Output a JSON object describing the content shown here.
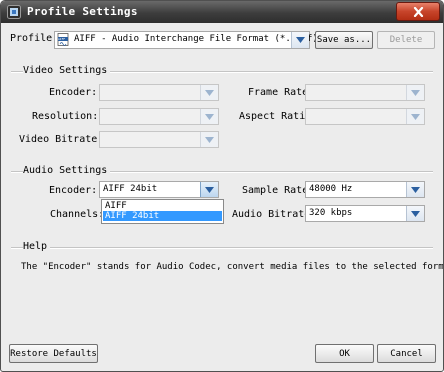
{
  "window": {
    "title": "Profile Settings"
  },
  "profile": {
    "label": "Profile:",
    "value": "AIFF - Audio Interchange File Format (*.aiff)",
    "format_icon_text": "AIFF",
    "save_as": "Save as...",
    "delete": "Delete"
  },
  "video": {
    "section": "Video Settings",
    "encoder_label": "Encoder:",
    "resolution_label": "Resolution:",
    "bitrate_label": "Video Bitrate:",
    "framerate_label": "Frame Rate:",
    "aspect_label": "Aspect Ratio:"
  },
  "audio": {
    "section": "Audio Settings",
    "encoder_label": "Encoder:",
    "encoder_value": "AIFF 24bit",
    "channels_label": "Channels:",
    "samplerate_label": "Sample Rate:",
    "samplerate_value": "48000 Hz",
    "bitrate_label": "Audio Bitrate:",
    "bitrate_value": "320 kbps",
    "encoder_options": [
      "AIFF",
      "AIFF 24bit"
    ],
    "selected_option": "AIFF 24bit"
  },
  "help": {
    "section": "Help",
    "text": "The \"Encoder\" stands for Audio Codec, convert media files to the selected format."
  },
  "buttons": {
    "restore": "Restore Defaults",
    "ok": "OK",
    "cancel": "Cancel"
  },
  "colors": {
    "accent_blue": "#3399ff",
    "title_bar": "#3d3d3d",
    "close_red": "#c7442a",
    "arrow_blue": "#2b5fa0"
  }
}
